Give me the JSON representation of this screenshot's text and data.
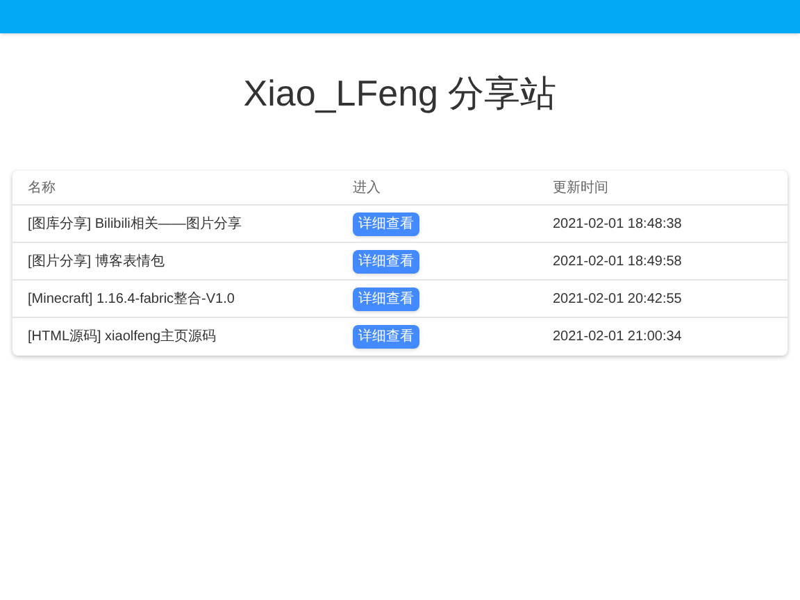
{
  "title": "Xiao_LFeng 分享站",
  "table": {
    "columns": [
      "名称",
      "进入",
      "更新时间"
    ],
    "rows": [
      {
        "name": "[图库分享] Bilibili相关——图片分享",
        "button": "详细查看",
        "updated": "2021-02-01 18:48:38"
      },
      {
        "name": "[图片分享] 博客表情包",
        "button": "详细查看",
        "updated": "2021-02-01 18:49:58"
      },
      {
        "name": "[Minecraft] 1.16.4-fabric整合-V1.0",
        "button": "详细查看",
        "updated": "2021-02-01 20:42:55"
      },
      {
        "name": "[HTML源码] xiaolfeng主页源码",
        "button": "详细查看",
        "updated": "2021-02-01 21:00:34"
      }
    ]
  }
}
